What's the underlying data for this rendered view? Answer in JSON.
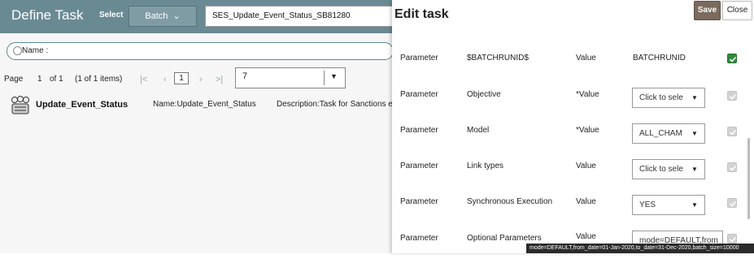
{
  "app": {
    "title": "Define Task",
    "select_label": "Select",
    "batch_button": "Batch",
    "batch_value": "SES_Update_Event_Status_SB81280",
    "search_label": "Name :",
    "pager": {
      "page_label": "Page",
      "current": "1",
      "of_text": "of 1",
      "items_text": "(1 of 1 items)",
      "page_box": "1",
      "page_size": "7"
    },
    "task": {
      "name": "Update_Event_Status",
      "name_field": "Name:Update_Event_Status",
      "description": "Description:Task for Sanctions ev"
    }
  },
  "drawer": {
    "title": "Edit task",
    "save_label": "Save",
    "close_label": "Close",
    "rows": [
      {
        "label": "Parameter",
        "name": "$BATCHRUNID$",
        "value_label": "Value",
        "value": "BATCHRUNID",
        "checked": true
      },
      {
        "label": "Parameter",
        "name": "Objective",
        "value_label": "*Value",
        "value": "Click to sele",
        "checked": false
      },
      {
        "label": "Parameter",
        "name": "Model",
        "value_label": "*Value",
        "value": "ALL_CHAM",
        "checked": false
      },
      {
        "label": "Parameter",
        "name": "Link types",
        "value_label": "Value",
        "value": "Click to sele",
        "checked": false
      },
      {
        "label": "Parameter",
        "name": "Synchronous Execution",
        "value_label": "Value",
        "value": "YES",
        "checked": false
      },
      {
        "label": "Parameter",
        "name": "Optional Parameters",
        "value_label": "Value",
        "value": "mode=DEFAULT,from",
        "checked": false
      }
    ],
    "tooltip": "mode=DEFAULT,from_date=01-Jan-2020,to_date=31-Dec-2020,batch_size=10000"
  },
  "colors": {
    "header": "#6a8a93",
    "save": "#7a6b5e",
    "check_on": "#2f8a3c"
  }
}
